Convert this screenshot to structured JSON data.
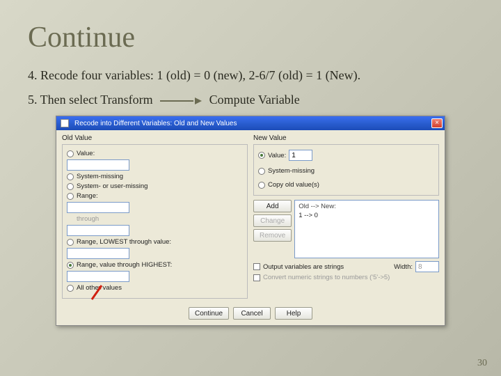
{
  "slide": {
    "title": "Continue",
    "line1": "4. Recode four  variables: 1 (old) = 0 (new), 2-6/7 (old) = 1 (New).",
    "line2_left": "5. Then select Transform",
    "line2_right": "Compute  Variable",
    "page_number": "30"
  },
  "dialog": {
    "title": "Recode into Different Variables: Old and New Values",
    "close_symbol": "×",
    "old": {
      "heading": "Old Value",
      "opt_value": "Value:",
      "opt_sys_missing": "System-missing",
      "opt_sys_user_missing": "System- or user-missing",
      "opt_range": "Range:",
      "through": "through",
      "opt_range_lowest": "Range, LOWEST through value:",
      "opt_range_highest": "Range, value through HIGHEST:",
      "opt_all_other": "All other values"
    },
    "new": {
      "heading": "New Value",
      "opt_value": "Value:",
      "value_input": "1",
      "opt_sys_missing": "System-missing",
      "opt_copy_old": "Copy old value(s)"
    },
    "map": {
      "heading": "Old --> New:",
      "btn_add": "Add",
      "btn_change": "Change",
      "btn_remove": "Remove",
      "entries": [
        "1 --> 0"
      ]
    },
    "checks": {
      "output_strings": "Output variables are strings",
      "width_label": "Width:",
      "width_value": "8",
      "convert_numeric": "Convert numeric strings to numbers ('5'->5)"
    },
    "buttons": {
      "continue": "Continue",
      "cancel": "Cancel",
      "help": "Help"
    }
  }
}
